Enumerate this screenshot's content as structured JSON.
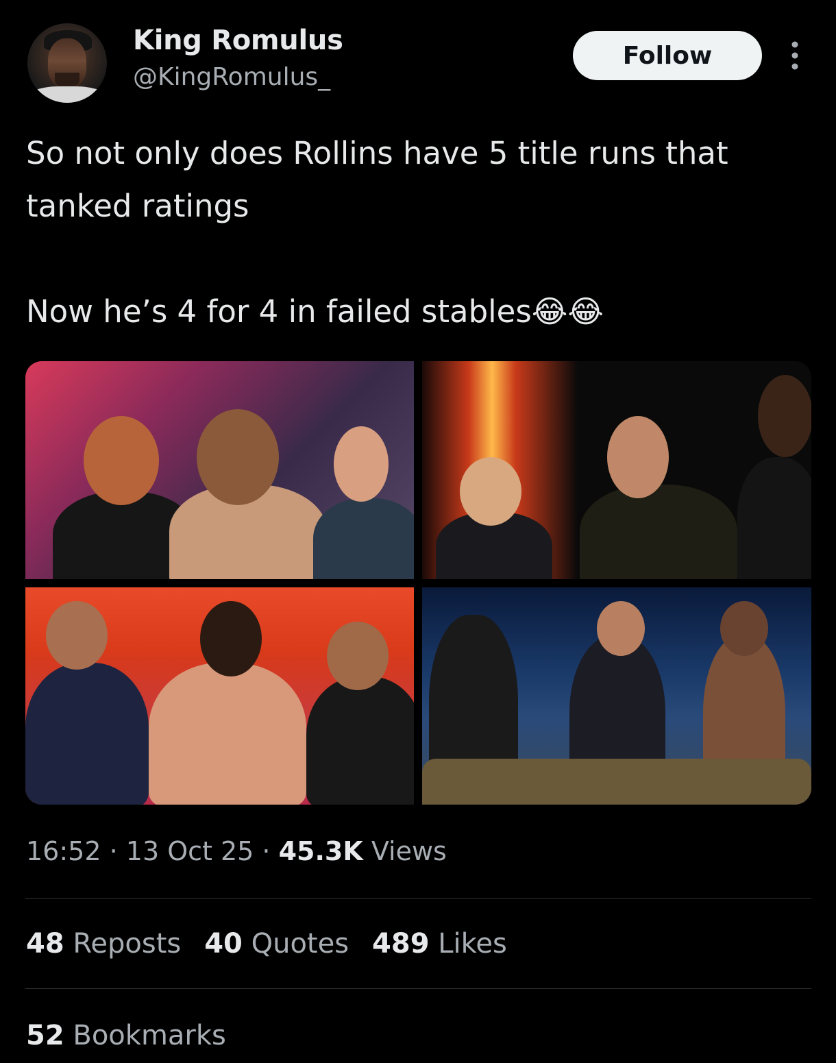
{
  "author": {
    "display_name": "King Romulus",
    "handle": "@KingRomulus_"
  },
  "follow_label": "Follow",
  "tweet": {
    "line1": "So not only does Rollins have 5 title runs that tanked ratings",
    "line2": "Now he’s 4 for 4 in failed stables😂😂"
  },
  "meta": {
    "time": "16:52",
    "sep1": " · ",
    "date": "13 Oct 25",
    "sep2": " · ",
    "views_count": "45.3K",
    "views_label": " Views"
  },
  "stats": {
    "reposts_count": "48",
    "reposts_label": " Reposts",
    "quotes_count": "40",
    "quotes_label": " Quotes",
    "likes_count": "489",
    "likes_label": " Likes",
    "bookmarks_count": "52",
    "bookmarks_label": " Bookmarks"
  },
  "colors": {
    "background": "#000000",
    "text_primary": "#e7e9ea",
    "text_secondary": "#a8aeb3",
    "divider": "#2f3336",
    "follow_bg": "#eff3f4"
  },
  "icons": {
    "more": "more-vertical-icon"
  }
}
